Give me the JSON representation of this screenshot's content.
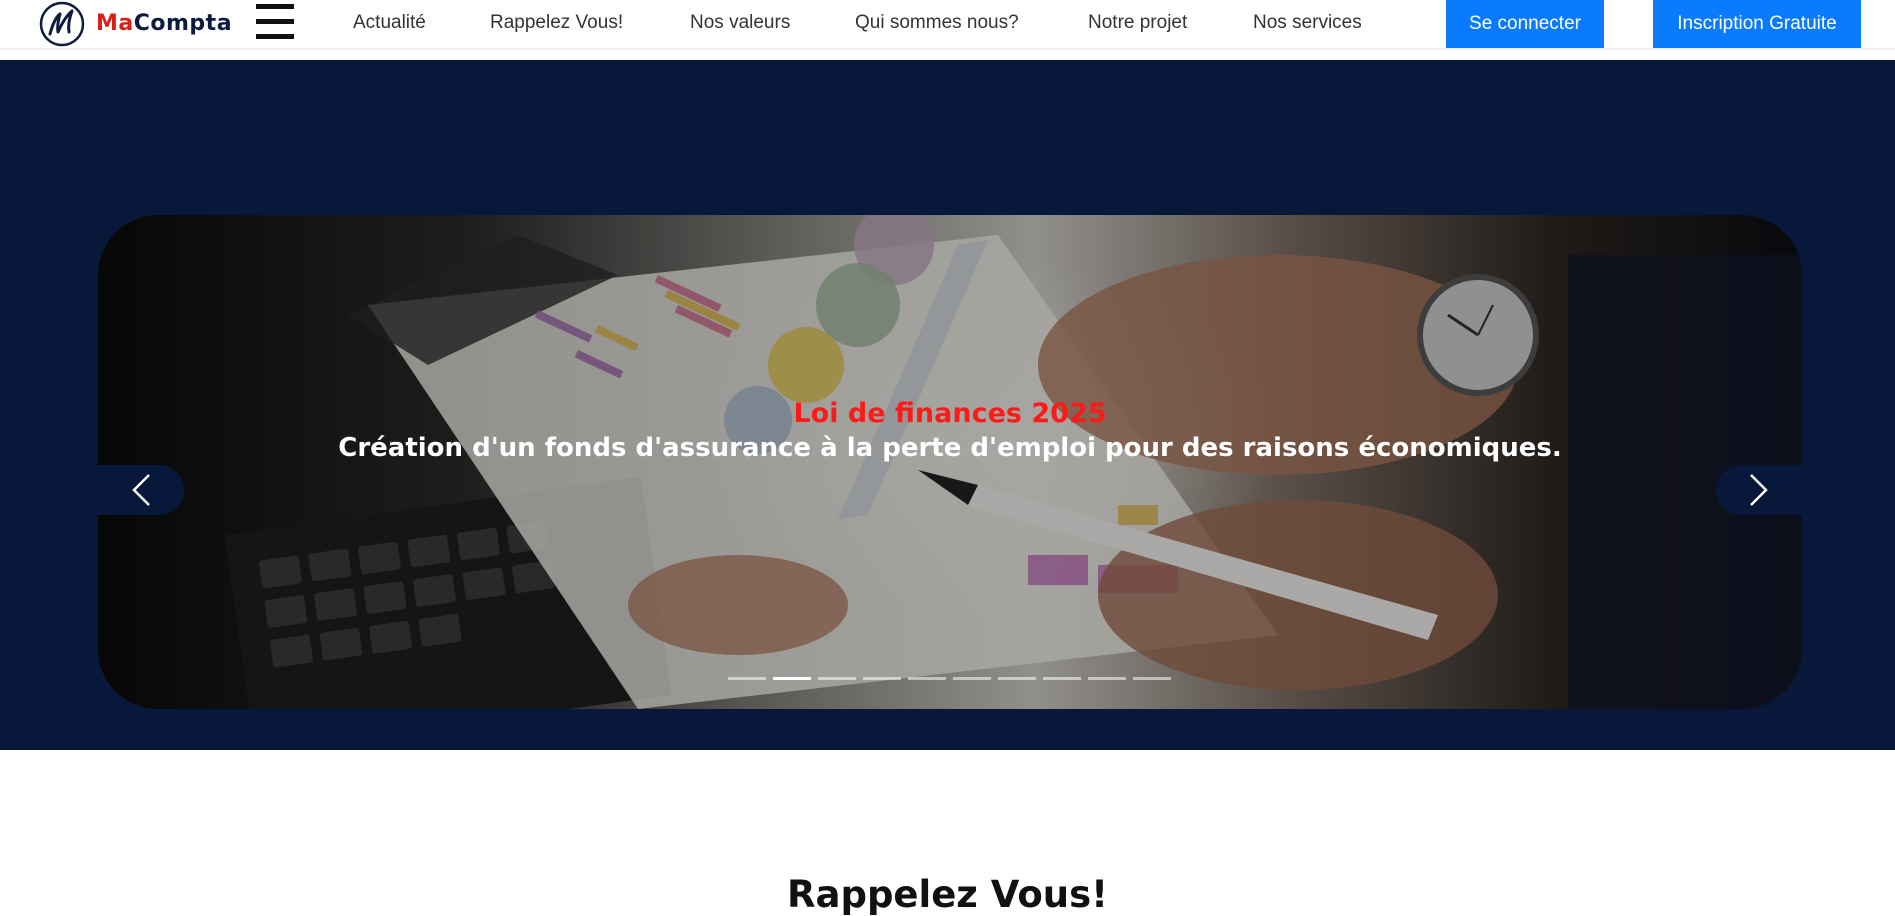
{
  "header": {
    "logo": {
      "part1": "Ma",
      "part2": "Compta"
    },
    "nav": [
      {
        "label": "Actualité"
      },
      {
        "label": "Rappelez Vous!"
      },
      {
        "label": "Nos valeurs"
      },
      {
        "label": "Qui sommes nous?"
      },
      {
        "label": "Notre projet"
      },
      {
        "label": "Nos services"
      }
    ],
    "login_label": "Se connecter",
    "signup_label": "Inscription Gratuite"
  },
  "hero": {
    "slide": {
      "title": "Loi de finances 2025",
      "text": "Création d'un fonds d'assurance à la perte d'emploi pour des raisons économiques."
    },
    "indicator_count": 10,
    "active_indicator": 2
  },
  "section": {
    "title": "Rappelez Vous!"
  },
  "colors": {
    "primary_button": "#0a7bff",
    "hero_background": "#08183a",
    "logo_red": "#d91e18",
    "caption_title": "#ff1a1a"
  },
  "icons": [
    "menu-icon",
    "chevron-left-icon",
    "chevron-right-icon"
  ]
}
